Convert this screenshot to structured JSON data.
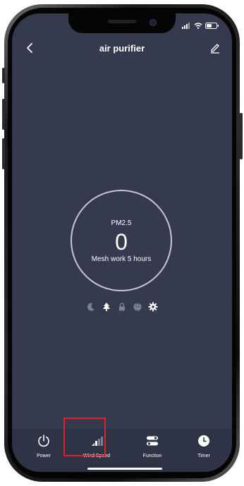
{
  "header": {
    "title": "air purifier",
    "back_icon": "chevron-left-icon",
    "edit_icon": "pencil-icon"
  },
  "status_bar": {
    "icons": [
      "signal-icon",
      "wifi-icon",
      "battery-icon"
    ]
  },
  "sensor": {
    "label": "PM2.5",
    "value": "0",
    "subtext": "Mesh work 5 hours"
  },
  "modes": [
    {
      "icon": "moon-icon",
      "active": false
    },
    {
      "icon": "tree-icon",
      "active": true
    },
    {
      "icon": "lock-icon",
      "active": false
    },
    {
      "icon": "child-face-icon",
      "active": false
    },
    {
      "icon": "gear-icon",
      "active": true
    }
  ],
  "tabs": [
    {
      "label": "Power",
      "icon": "power-icon"
    },
    {
      "label": "Wind Speed",
      "icon": "wind-speed-bars-icon"
    },
    {
      "label": "Function",
      "icon": "function-toggles-icon"
    },
    {
      "label": "Timer",
      "icon": "clock-icon"
    }
  ],
  "colors": {
    "screen_bg": "#363a4f",
    "bottom_bar_bg": "#2f3346",
    "highlight": "#e0202a",
    "active_icon": "#ffffff",
    "inactive_icon": "#7c8096"
  }
}
